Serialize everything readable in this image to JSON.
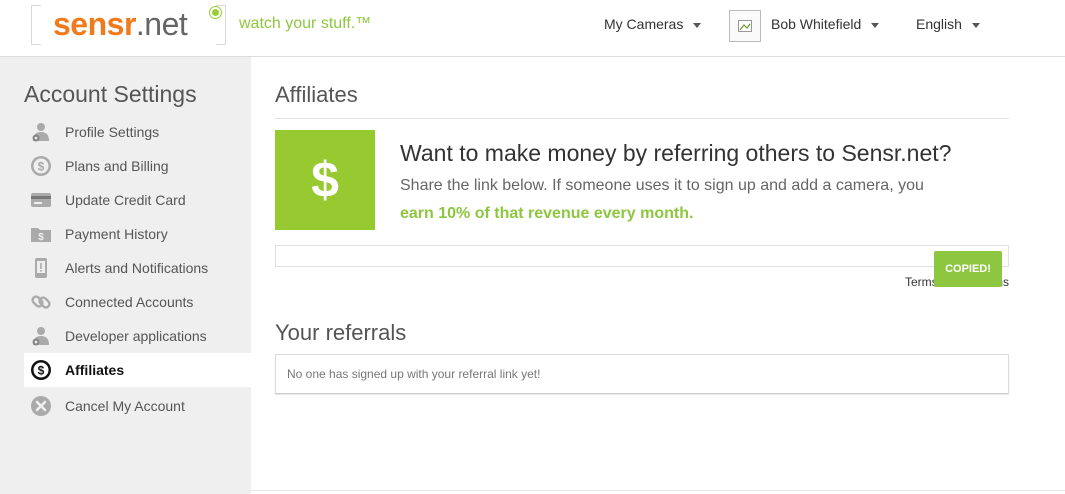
{
  "header": {
    "logo_text_orange": "sensr",
    "logo_text_gray": ".net",
    "tagline": "watch your stuff.™",
    "nav": {
      "cameras": "My Cameras",
      "user_name": "Bob Whitefield",
      "language": "English"
    }
  },
  "sidebar": {
    "title": "Account Settings",
    "items": [
      {
        "label": "Profile Settings",
        "icon": "gear-user-icon"
      },
      {
        "label": "Plans and Billing",
        "icon": "dollar-circle-icon"
      },
      {
        "label": "Update Credit Card",
        "icon": "credit-card-icon"
      },
      {
        "label": "Payment History",
        "icon": "folder-dollar-icon"
      },
      {
        "label": "Alerts and Notifications",
        "icon": "phone-alert-icon"
      },
      {
        "label": "Connected Accounts",
        "icon": "link-icon"
      },
      {
        "label": "Developer applications",
        "icon": "gear-user-icon"
      },
      {
        "label": "Affiliates",
        "icon": "dollar-circle-icon",
        "active": true
      },
      {
        "label": "Cancel My Account",
        "icon": "close-circle-icon"
      }
    ]
  },
  "main": {
    "title": "Affiliates",
    "dollar_symbol": "$",
    "pitch_heading": "Want to make money by referring others to Sensr.net?",
    "pitch_line": "Share the link below. If someone uses it to sign up and add a camera, you",
    "pitch_earn": "earn 10% of that revenue every month.",
    "referral_link_value": "",
    "terms_label": "Terms & Conditions",
    "copied_label": "COPIED!",
    "referrals_title": "Your referrals",
    "referrals_empty": "No one has signed up with your referral link yet!"
  },
  "colors": {
    "brand_orange": "#f07a1c",
    "brand_green": "#8dc63f",
    "dollar_box": "#97c931",
    "sidebar_bg": "#efefef"
  }
}
